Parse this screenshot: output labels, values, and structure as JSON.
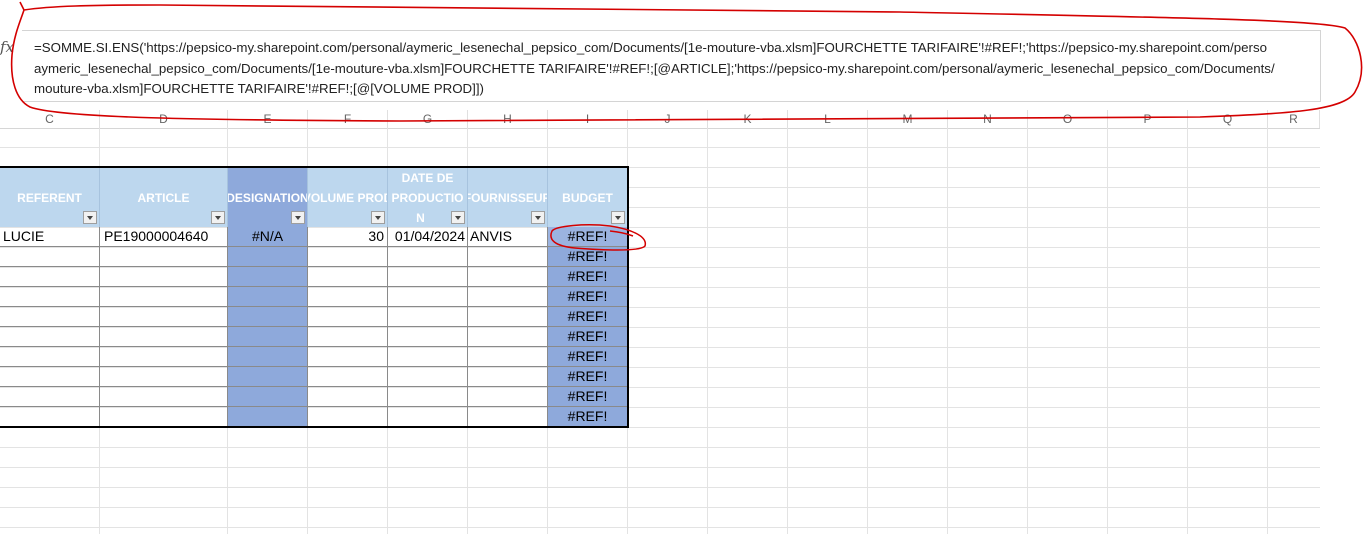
{
  "formula_bar": {
    "fx_label": "fx",
    "formula_lines": [
      "=SOMME.SI.ENS('https://pepsico-my.sharepoint.com/personal/aymeric_lesenechal_pepsico_com/Documents/[1e-mouture-vba.xlsm]FOURCHETTE TARIFAIRE'!#REF!;'https://pepsico-my.sharepoint.com/perso",
      "aymeric_lesenechal_pepsico_com/Documents/[1e-mouture-vba.xlsm]FOURCHETTE TARIFAIRE'!#REF!;[@ARTICLE];'https://pepsico-my.sharepoint.com/personal/aymeric_lesenechal_pepsico_com/Documents/",
      "mouture-vba.xlsm]FOURCHETTE TARIFAIRE'!#REF!;[@[VOLUME PROD]])"
    ]
  },
  "column_headers": [
    "C",
    "D",
    "E",
    "F",
    "G",
    "H",
    "I",
    "J",
    "K",
    "L",
    "M",
    "N",
    "O",
    "P",
    "Q",
    "R"
  ],
  "table": {
    "headers": [
      "REFERENT",
      "ARTICLE",
      "DESIGNATION",
      "VOLUME PROD",
      "DATE DE PRODUCTION",
      "FOURNISSEUR",
      "BUDGET"
    ],
    "date_header_lines": [
      "DATE DE",
      "PRODUCTIO",
      "N"
    ],
    "row1": {
      "referent": "LUCIE",
      "article": "PE19000004640",
      "designation": "#N/A",
      "volume": "30",
      "date": "01/04/2024",
      "fournisseur": "ANVIS",
      "budget": "#REF!"
    },
    "budget_rest": [
      "#REF!",
      "#REF!",
      "#REF!",
      "#REF!",
      "#REF!",
      "#REF!",
      "#REF!",
      "#REF!",
      "#REF!"
    ]
  },
  "colors": {
    "header_light": "#bdd7ee",
    "header_dark": "#8ea9db",
    "annotation": "#d40000"
  }
}
